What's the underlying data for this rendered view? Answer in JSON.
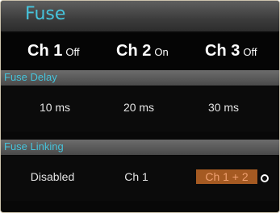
{
  "title": "Fuse",
  "channels": [
    {
      "name": "Ch 1",
      "state": "Off"
    },
    {
      "name": "Ch 2",
      "state": "On"
    },
    {
      "name": "Ch 3",
      "state": "Off"
    }
  ],
  "fuse_delay": {
    "label": "Fuse Delay",
    "values": [
      "10 ms",
      "20 ms",
      "30 ms"
    ]
  },
  "fuse_linking": {
    "label": "Fuse Linking",
    "options": [
      "Disabled",
      "Ch 1",
      "Ch 1 + 2"
    ],
    "selected": "Ch 1 + 2"
  },
  "colors": {
    "accent": "#46c4dc",
    "selection": "#a55a22"
  },
  "icons": [
    "cursor-icon"
  ]
}
